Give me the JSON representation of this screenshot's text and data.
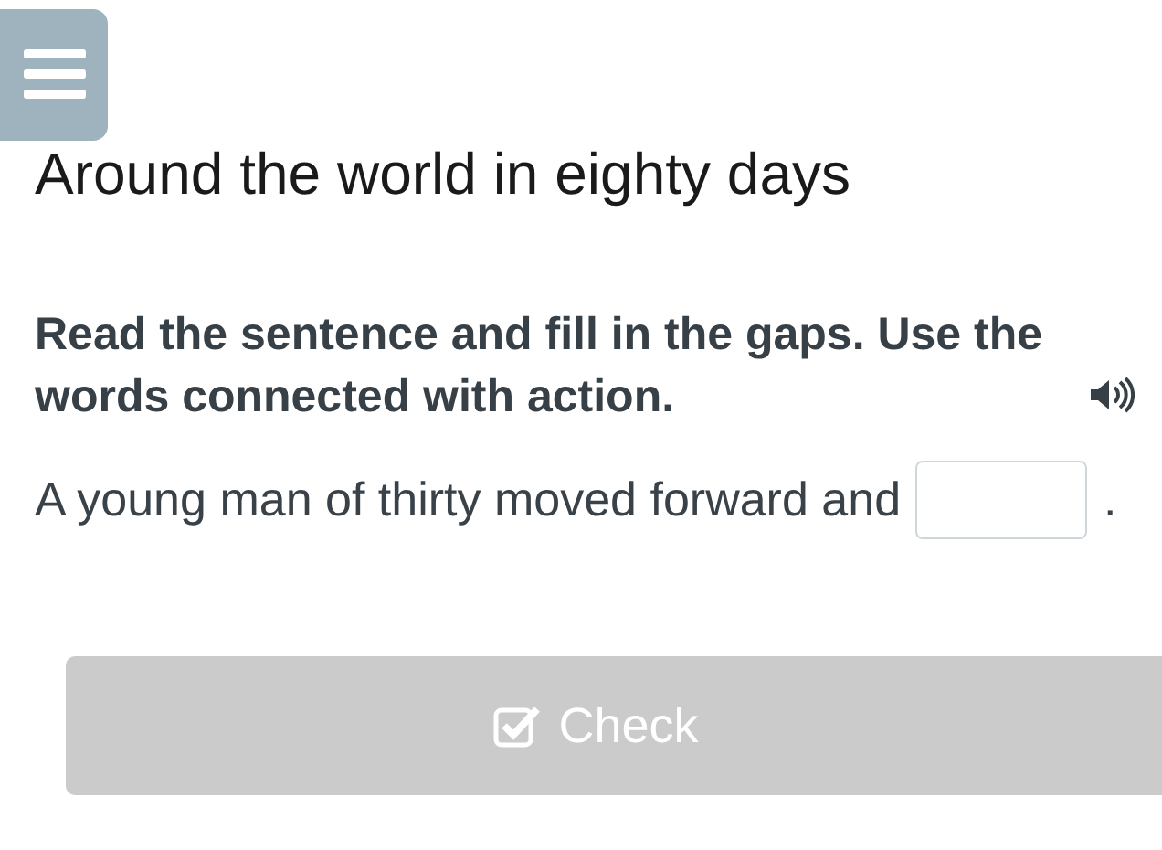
{
  "title": "Around the world in eighty days",
  "instruction": "Read the sentence and fill in the gaps. Use the words connected with action.",
  "sentence": {
    "before": "A young man of thirty moved forward and",
    "after": "."
  },
  "check_button": {
    "label": "Check",
    "disabled": true
  }
}
